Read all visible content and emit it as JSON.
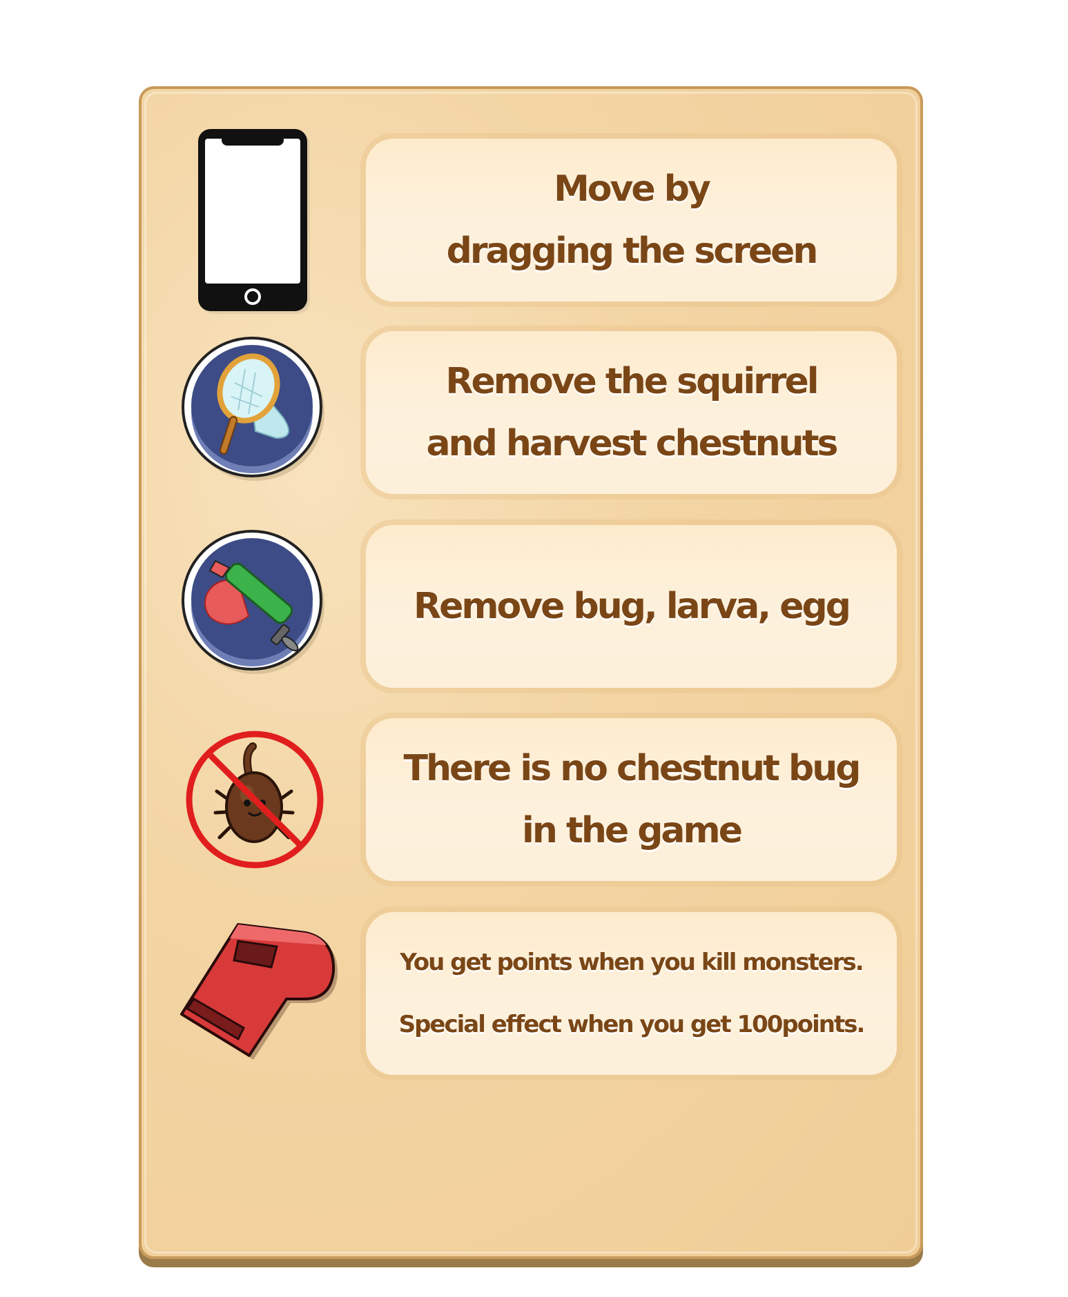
{
  "rows": [
    {
      "icon": "smartphone-icon",
      "lines": [
        "Move by",
        "dragging the screen"
      ]
    },
    {
      "icon": "bug-net-icon",
      "lines": [
        "Remove the squirrel",
        "and harvest chestnuts"
      ]
    },
    {
      "icon": "pesticide-sprayer-icon",
      "lines": [
        "Remove bug, larva, egg"
      ]
    },
    {
      "icon": "no-bug-icon",
      "lines": [
        "There is no chestnut bug",
        "in the game"
      ]
    },
    {
      "icon": "whistle-icon",
      "lines": [
        "You get points when you kill monsters.",
        "Special effect when you get 100points."
      ]
    }
  ],
  "colors": {
    "panel": "#f0cd96",
    "card": "#fdf0da",
    "text": "#7a4616",
    "icon_circle": "#4a5a8c",
    "no_sign": "#e01e1e",
    "whistle": "#d83a3a"
  }
}
